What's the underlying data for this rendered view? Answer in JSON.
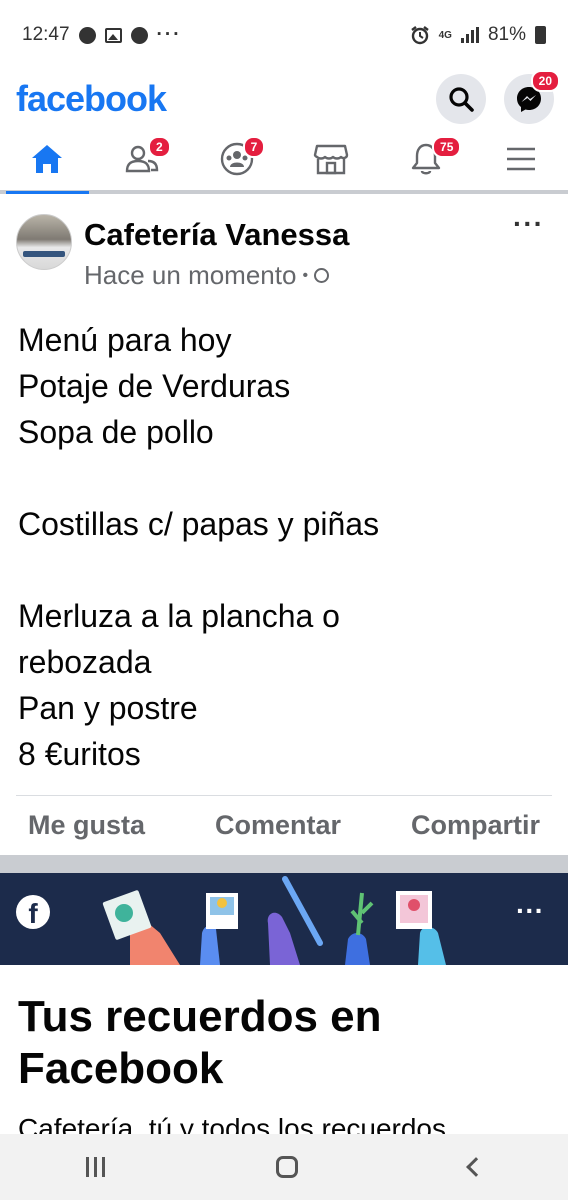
{
  "status_bar": {
    "time": "12:47",
    "notification_icons": [
      "facebook-icon",
      "gallery-icon",
      "facebook-icon"
    ],
    "more": "···",
    "network": "4G",
    "battery": "81%"
  },
  "header": {
    "logo": "facebook",
    "messenger_badge": "20"
  },
  "tabs": [
    {
      "name": "home",
      "badge": ""
    },
    {
      "name": "friends",
      "badge": "2"
    },
    {
      "name": "groups",
      "badge": "7"
    },
    {
      "name": "marketplace",
      "badge": ""
    },
    {
      "name": "notifications",
      "badge": "75"
    },
    {
      "name": "menu",
      "badge": ""
    }
  ],
  "post": {
    "author": "Cafetería Vanessa",
    "time": "Hace un momento",
    "separator": "•",
    "more": "···",
    "lines": [
      "Menú  para hoy",
      "Potaje de Verduras",
      "Sopa de pollo",
      "",
      "Costillas c/ papas y piñas",
      "",
      "Merluza a la plancha o",
      "rebozada",
      "Pan y postre",
      "8 €uritos"
    ],
    "actions": {
      "like": "Me gusta",
      "comment": "Comentar",
      "share": "Compartir"
    }
  },
  "memories": {
    "fb_letter": "f",
    "more": "···",
    "title_line1": "Tus recuerdos en",
    "title_line2": "Facebook",
    "subtitle": "Cafetería, tú y todos los recuerdos"
  },
  "colors": {
    "brand": "#1877f2",
    "badge": "#e41e3f",
    "banner": "#1c2b4b"
  }
}
